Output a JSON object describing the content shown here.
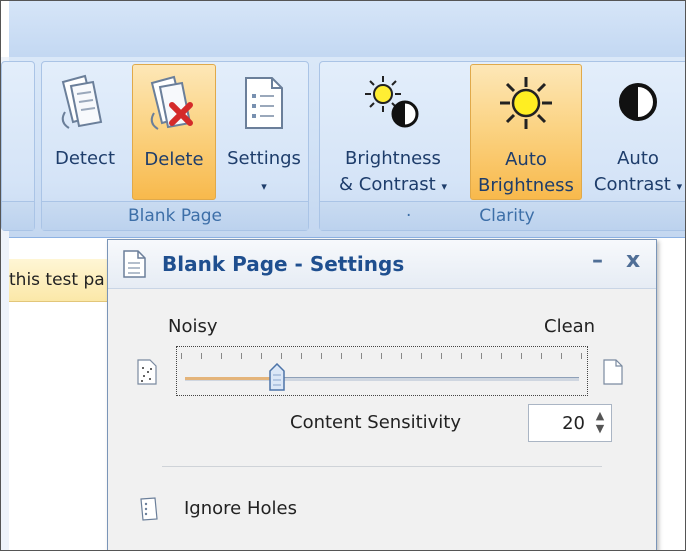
{
  "ribbon": {
    "blank_page_group": {
      "label": "Blank Page",
      "buttons": [
        {
          "label": "Detect",
          "icon": "detect-pages-icon"
        },
        {
          "label": "Delete",
          "icon": "delete-page-icon",
          "active": true
        },
        {
          "label": "Settings",
          "icon": "settings-page-icon",
          "dropdown": "▾"
        }
      ]
    },
    "clarity_group": {
      "label": "Clarity",
      "dot": "·",
      "buttons": [
        {
          "line1": "Brightness",
          "line2": "& Contrast",
          "icon": "brightness-contrast-icon",
          "dropdown": "▾"
        },
        {
          "line1": "Auto",
          "line2": "Brightness",
          "icon": "sun-icon",
          "active": true
        },
        {
          "line1": "Auto",
          "line2": "Contrast",
          "icon": "contrast-icon",
          "dropdown": "▾"
        }
      ]
    }
  },
  "document": {
    "banner_text": "this test pa"
  },
  "panel": {
    "title": "Blank Page - Settings",
    "minimize": "–",
    "close": "x",
    "slider": {
      "left_label": "Noisy",
      "right_label": "Clean",
      "value_fraction": 0.22
    },
    "sensitivity": {
      "label": "Content Sensitivity",
      "value": "20",
      "up": "▲",
      "down": "▼"
    },
    "ignore_holes_label": "Ignore Holes"
  },
  "colors": {
    "ribbon": "#cfe0f5",
    "active_button": "#f8b94c",
    "title_text": "#1f4f8f"
  }
}
